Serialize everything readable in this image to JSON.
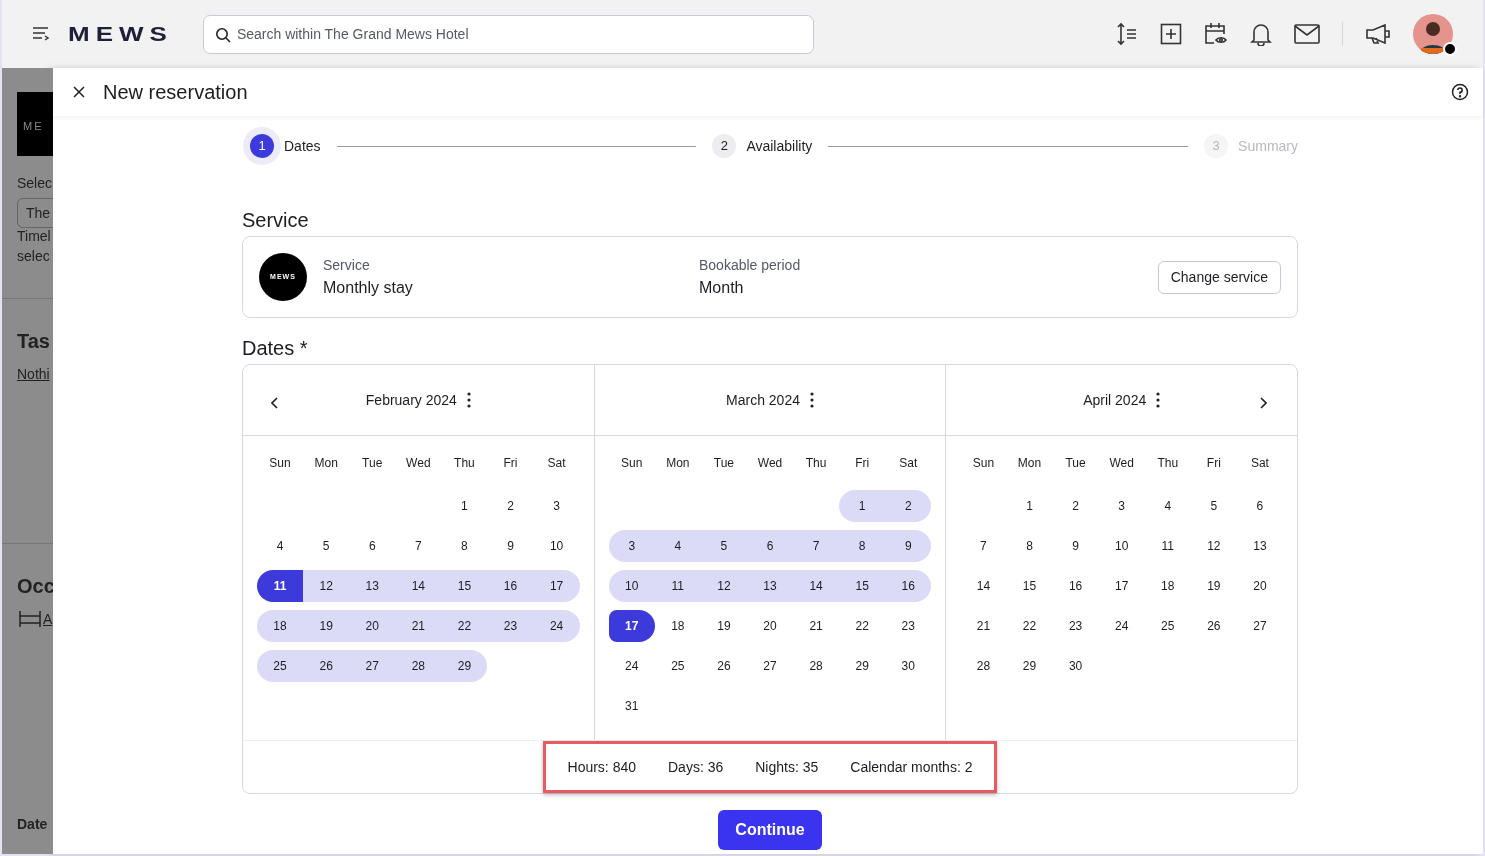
{
  "topbar": {
    "logo": "MEWS",
    "search": {
      "placeholder": "Search within The Grand Mews Hotel"
    }
  },
  "background": {
    "logo": "ME",
    "texts": [
      "Selec",
      "The",
      "Timel",
      "selec"
    ],
    "tasks_title": "Tas",
    "tasks_link": "Nothi",
    "occupancy_title": "Occ",
    "occupancy_link": "A",
    "footer": "Date"
  },
  "panel": {
    "title": "New reservation"
  },
  "steps": [
    {
      "number": "1",
      "label": "Dates",
      "active": true,
      "disabled": false
    },
    {
      "number": "2",
      "label": "Availability",
      "active": false,
      "disabled": false
    },
    {
      "number": "3",
      "label": "Summary",
      "active": false,
      "disabled": true
    }
  ],
  "service": {
    "heading": "Service",
    "logo": "MEWS",
    "service_label": "Service",
    "service_value": "Monthly stay",
    "period_label": "Bookable period",
    "period_value": "Month",
    "button": "Change service"
  },
  "dates": {
    "heading": "Dates",
    "required_mark": "*",
    "months": [
      {
        "title": "February 2024",
        "weekdays": [
          "Sun",
          "Mon",
          "Tue",
          "Wed",
          "Thu",
          "Fri",
          "Sat"
        ],
        "weeks": [
          [
            {
              "day": "1",
              "selected": false,
              "in_range": false
            },
            {
              "day": "2",
              "selected": false,
              "in_range": false
            },
            {
              "day": "3",
              "selected": false,
              "in_range": false
            }
          ],
          [
            {
              "day": "4",
              "selected": false,
              "in_range": false
            },
            {
              "day": "5",
              "selected": false,
              "in_range": false
            },
            {
              "day": "6",
              "selected": false,
              "in_range": false
            },
            {
              "day": "7",
              "selected": false,
              "in_range": false
            },
            {
              "day": "8",
              "selected": false,
              "in_range": false
            },
            {
              "day": "9",
              "selected": false,
              "in_range": false
            },
            {
              "day": "10",
              "selected": false,
              "in_range": false
            }
          ],
          [
            {
              "day": "11",
              "selected": true,
              "in_range": true
            },
            {
              "day": "12",
              "selected": false,
              "in_range": true
            },
            {
              "day": "13",
              "selected": false,
              "in_range": true
            },
            {
              "day": "14",
              "selected": false,
              "in_range": true
            },
            {
              "day": "15",
              "selected": false,
              "in_range": true
            },
            {
              "day": "16",
              "selected": false,
              "in_range": true
            },
            {
              "day": "17",
              "selected": false,
              "in_range": true
            }
          ],
          [
            {
              "day": "18",
              "selected": false,
              "in_range": true
            },
            {
              "day": "19",
              "selected": false,
              "in_range": true
            },
            {
              "day": "20",
              "selected": false,
              "in_range": true
            },
            {
              "day": "21",
              "selected": false,
              "in_range": true
            },
            {
              "day": "22",
              "selected": false,
              "in_range": true
            },
            {
              "day": "23",
              "selected": false,
              "in_range": true
            },
            {
              "day": "24",
              "selected": false,
              "in_range": true
            }
          ],
          [
            {
              "day": "25",
              "selected": false,
              "in_range": true
            },
            {
              "day": "26",
              "selected": false,
              "in_range": true
            },
            {
              "day": "27",
              "selected": false,
              "in_range": true
            },
            {
              "day": "28",
              "selected": false,
              "in_range": true
            },
            {
              "day": "29",
              "selected": false,
              "in_range": true
            }
          ]
        ]
      },
      {
        "title": "March 2024",
        "weekdays": [
          "Sun",
          "Mon",
          "Tue",
          "Wed",
          "Thu",
          "Fri",
          "Sat"
        ],
        "weeks": [
          [
            {
              "day": "1",
              "selected": false,
              "in_range": true
            },
            {
              "day": "2",
              "selected": false,
              "in_range": true
            }
          ],
          [
            {
              "day": "3",
              "selected": false,
              "in_range": true
            },
            {
              "day": "4",
              "selected": false,
              "in_range": true
            },
            {
              "day": "5",
              "selected": false,
              "in_range": true
            },
            {
              "day": "6",
              "selected": false,
              "in_range": true
            },
            {
              "day": "7",
              "selected": false,
              "in_range": true
            },
            {
              "day": "8",
              "selected": false,
              "in_range": true
            },
            {
              "day": "9",
              "selected": false,
              "in_range": true
            }
          ],
          [
            {
              "day": "10",
              "selected": false,
              "in_range": true
            },
            {
              "day": "11",
              "selected": false,
              "in_range": true
            },
            {
              "day": "12",
              "selected": false,
              "in_range": true
            },
            {
              "day": "13",
              "selected": false,
              "in_range": true
            },
            {
              "day": "14",
              "selected": false,
              "in_range": true
            },
            {
              "day": "15",
              "selected": false,
              "in_range": true
            },
            {
              "day": "16",
              "selected": false,
              "in_range": true
            }
          ],
          [
            {
              "day": "17",
              "selected": true,
              "in_range": true
            },
            {
              "day": "18",
              "selected": false,
              "in_range": false
            },
            {
              "day": "19",
              "selected": false,
              "in_range": false
            },
            {
              "day": "20",
              "selected": false,
              "in_range": false
            },
            {
              "day": "21",
              "selected": false,
              "in_range": false
            },
            {
              "day": "22",
              "selected": false,
              "in_range": false
            },
            {
              "day": "23",
              "selected": false,
              "in_range": false
            }
          ],
          [
            {
              "day": "24",
              "selected": false,
              "in_range": false
            },
            {
              "day": "25",
              "selected": false,
              "in_range": false
            },
            {
              "day": "26",
              "selected": false,
              "in_range": false
            },
            {
              "day": "27",
              "selected": false,
              "in_range": false
            },
            {
              "day": "28",
              "selected": false,
              "in_range": false
            },
            {
              "day": "29",
              "selected": false,
              "in_range": false
            },
            {
              "day": "30",
              "selected": false,
              "in_range": false
            }
          ],
          [
            {
              "day": "31",
              "selected": false,
              "in_range": false
            }
          ]
        ]
      },
      {
        "title": "April 2024",
        "weekdays": [
          "Sun",
          "Mon",
          "Tue",
          "Wed",
          "Thu",
          "Fri",
          "Sat"
        ],
        "weeks": [
          [
            {
              "day": "1",
              "selected": false,
              "in_range": false
            },
            {
              "day": "2",
              "selected": false,
              "in_range": false
            },
            {
              "day": "3",
              "selected": false,
              "in_range": false
            },
            {
              "day": "4",
              "selected": false,
              "in_range": false
            },
            {
              "day": "5",
              "selected": false,
              "in_range": false
            },
            {
              "day": "6",
              "selected": false,
              "in_range": false
            }
          ],
          [
            {
              "day": "7",
              "selected": false,
              "in_range": false
            },
            {
              "day": "8",
              "selected": false,
              "in_range": false
            },
            {
              "day": "9",
              "selected": false,
              "in_range": false
            },
            {
              "day": "10",
              "selected": false,
              "in_range": false
            },
            {
              "day": "11",
              "selected": false,
              "in_range": false
            },
            {
              "day": "12",
              "selected": false,
              "in_range": false
            },
            {
              "day": "13",
              "selected": false,
              "in_range": false
            }
          ],
          [
            {
              "day": "14",
              "selected": false,
              "in_range": false
            },
            {
              "day": "15",
              "selected": false,
              "in_range": false
            },
            {
              "day": "16",
              "selected": false,
              "in_range": false
            },
            {
              "day": "17",
              "selected": false,
              "in_range": false
            },
            {
              "day": "18",
              "selected": false,
              "in_range": false
            },
            {
              "day": "19",
              "selected": false,
              "in_range": false
            },
            {
              "day": "20",
              "selected": false,
              "in_range": false
            }
          ],
          [
            {
              "day": "21",
              "selected": false,
              "in_range": false
            },
            {
              "day": "22",
              "selected": false,
              "in_range": false
            },
            {
              "day": "23",
              "selected": false,
              "in_range": false
            },
            {
              "day": "24",
              "selected": false,
              "in_range": false
            },
            {
              "day": "25",
              "selected": false,
              "in_range": false
            },
            {
              "day": "26",
              "selected": false,
              "in_range": false
            },
            {
              "day": "27",
              "selected": false,
              "in_range": false
            }
          ],
          [
            {
              "day": "28",
              "selected": false,
              "in_range": false
            },
            {
              "day": "29",
              "selected": false,
              "in_range": false
            },
            {
              "day": "30",
              "selected": false,
              "in_range": false
            }
          ]
        ]
      }
    ],
    "stats": [
      "Hours: 840",
      "Days: 36",
      "Nights: 35",
      "Calendar months: 2"
    ],
    "stats_highlighted": true
  },
  "continue_button": "Continue"
}
